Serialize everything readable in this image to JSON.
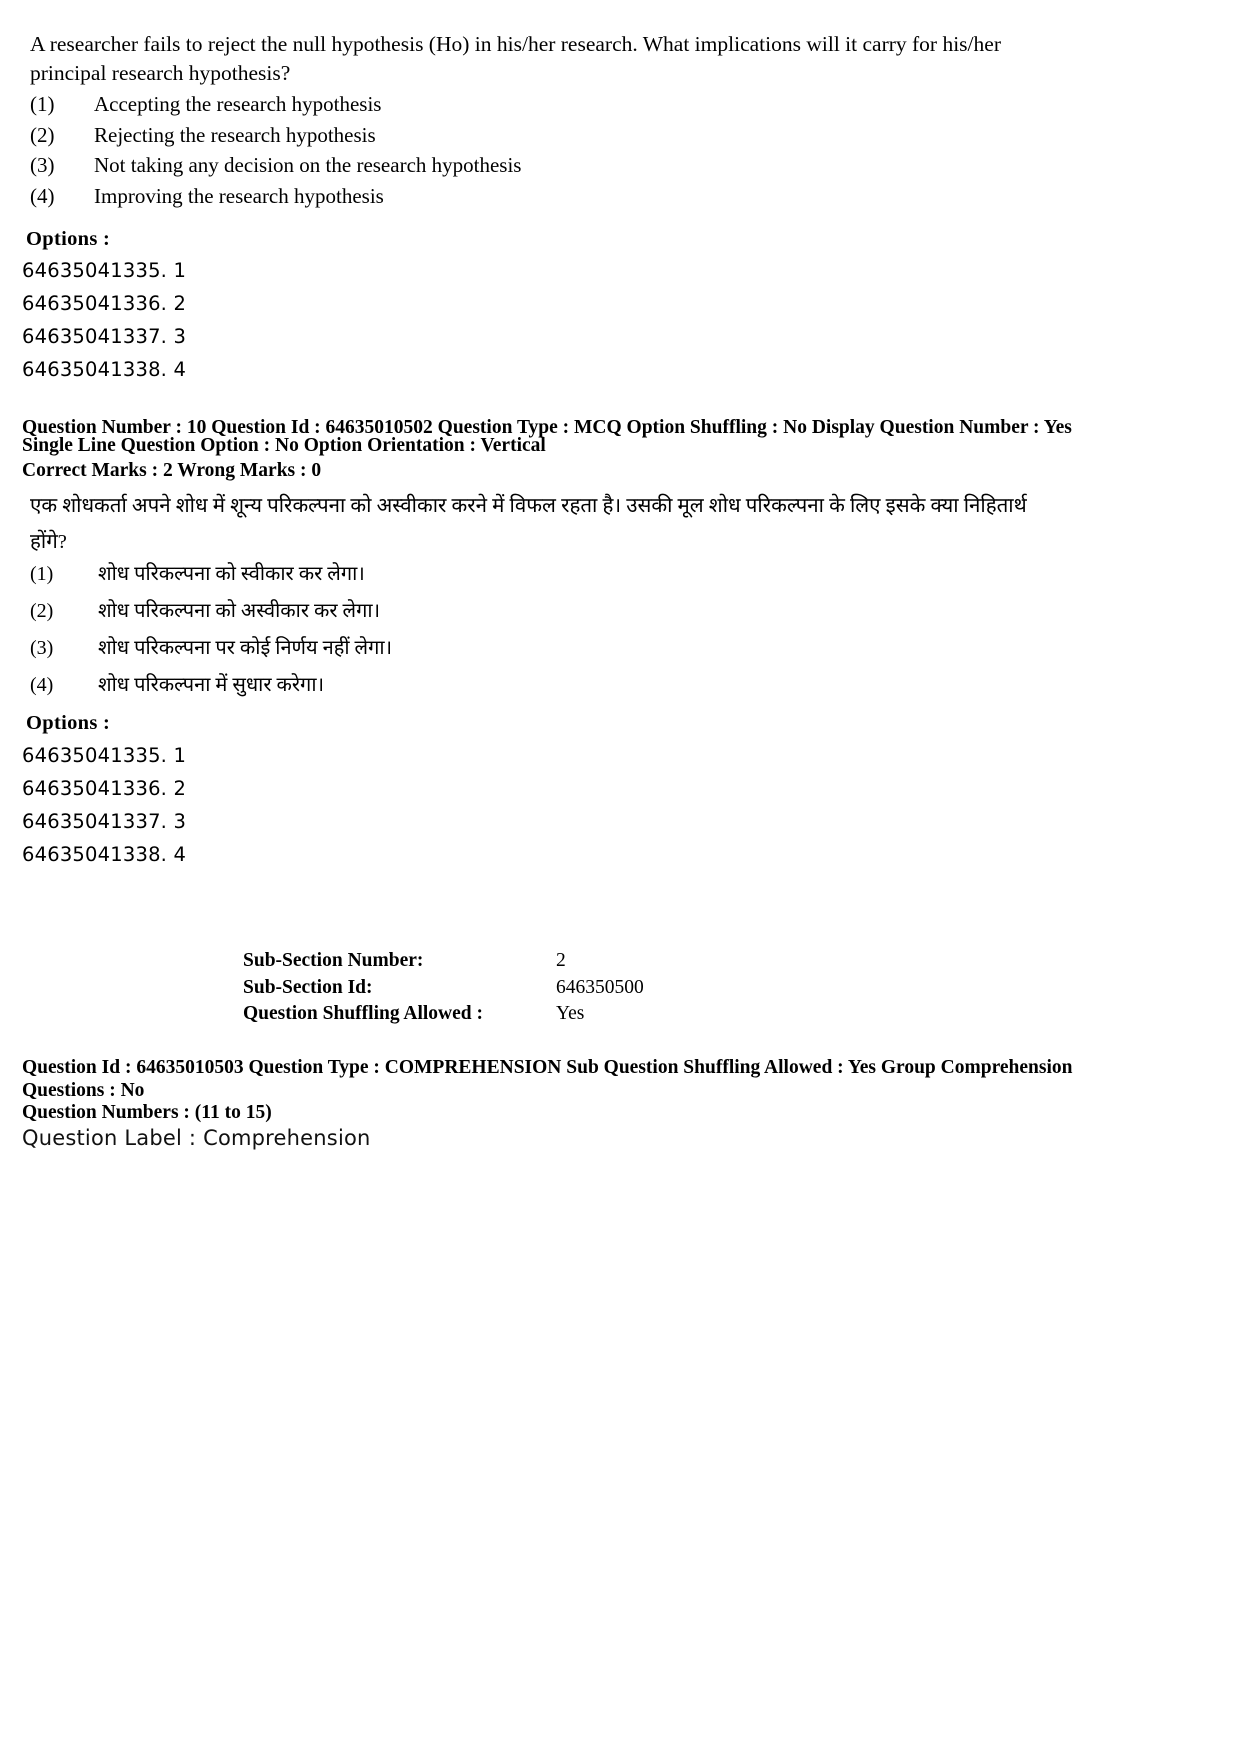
{
  "question_en": {
    "stem": "A researcher fails to reject the null hypothesis (Ho) in his/her research. What implications will it carry for his/her principal research hypothesis?",
    "options": [
      {
        "num": "(1)",
        "text": "Accepting the research hypothesis"
      },
      {
        "num": "(2)",
        "text": "Rejecting the research hypothesis"
      },
      {
        "num": "(3)",
        "text": "Not taking any decision on the research hypothesis"
      },
      {
        "num": "(4)",
        "text": "Improving the research hypothesis"
      }
    ],
    "options_heading": "Options :",
    "option_ids": [
      "64635041335. 1",
      "64635041336. 2",
      "64635041337. 3",
      "64635041338. 4"
    ]
  },
  "metadata": {
    "line1": "Question Number : 10  Question Id : 64635010502  Question Type : MCQ  Option Shuffling : No  Display Question Number : Yes",
    "line2": "Single Line Question Option : No  Option Orientation : Vertical",
    "line3": "Correct Marks : 2  Wrong Marks : 0"
  },
  "question_hi": {
    "stem": "एक शोधकर्ता अपने शोध में शून्य परिकल्पना को अस्वीकार करने में विफल रहता है। उसकी मूल शोध परिकल्पना के लिए इसके क्या निहितार्थ होंगे?",
    "options": [
      {
        "num": "(1)",
        "text": "शोध परिकल्पना को स्वीकार कर लेगा।"
      },
      {
        "num": "(2)",
        "text": "शोध परिकल्पना को अस्वीकार कर लेगा।"
      },
      {
        "num": "(3)",
        "text": "शोध परिकल्पना पर कोई निर्णय नहीं लेगा।"
      },
      {
        "num": "(4)",
        "text": "शोध परिकल्पना में सुधार करेगा।"
      }
    ],
    "options_heading": "Options :",
    "option_ids": [
      "64635041335. 1",
      "64635041336. 2",
      "64635041337. 3",
      "64635041338. 4"
    ]
  },
  "sub_section": {
    "rows": [
      {
        "label": "Sub-Section Number:",
        "value": "2"
      },
      {
        "label": "Sub-Section Id:",
        "value": "646350500"
      },
      {
        "label": "Question Shuffling Allowed :",
        "value": "Yes"
      }
    ]
  },
  "comprehension": {
    "line1": "Question Id : 64635010503  Question Type : COMPREHENSION  Sub Question Shuffling Allowed : Yes  Group Comprehension",
    "line2": "Questions : No",
    "numbers": "Question Numbers : (11 to 15)",
    "label": "Question Label : Comprehension"
  }
}
